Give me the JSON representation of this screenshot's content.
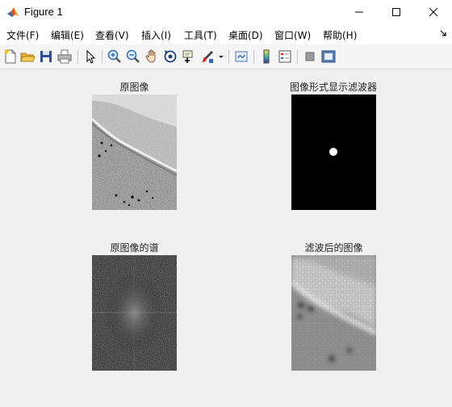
{
  "window": {
    "title": "Figure 1",
    "icon": "matlab-icon"
  },
  "window_controls": [
    "minimize-icon",
    "maximize-icon",
    "close-icon"
  ],
  "menu": {
    "items": [
      {
        "label": "文件(F)"
      },
      {
        "label": "编辑(E)"
      },
      {
        "label": "查看(V)"
      },
      {
        "label": "插入(I)"
      },
      {
        "label": "工具(T)"
      },
      {
        "label": "桌面(D)"
      },
      {
        "label": "窗口(W)"
      },
      {
        "label": "帮助(H)"
      }
    ]
  },
  "toolbar": {
    "buttons": [
      "new-figure-icon",
      "open-file-icon",
      "save-icon",
      "print-icon",
      "pointer-icon",
      "zoom-in-icon",
      "zoom-out-icon",
      "pan-icon",
      "rotate-3d-icon",
      "data-cursor-icon",
      "brush-icon",
      "link-plot-icon",
      "colorbar-icon",
      "legend-icon",
      "hide-plot-tools-icon",
      "show-plot-tools-icon"
    ]
  },
  "plots": {
    "original": {
      "title": "原图像"
    },
    "filter": {
      "title": "图像形式显示滤波器"
    },
    "spectrum": {
      "title": "原图像的谱"
    },
    "filtered": {
      "title": "滤波后的图像"
    }
  },
  "colors": {
    "background": "#f0f0f0",
    "filter_background": "#000000",
    "filter_dot": "#ffffff",
    "spectrum_background": "#202020"
  }
}
